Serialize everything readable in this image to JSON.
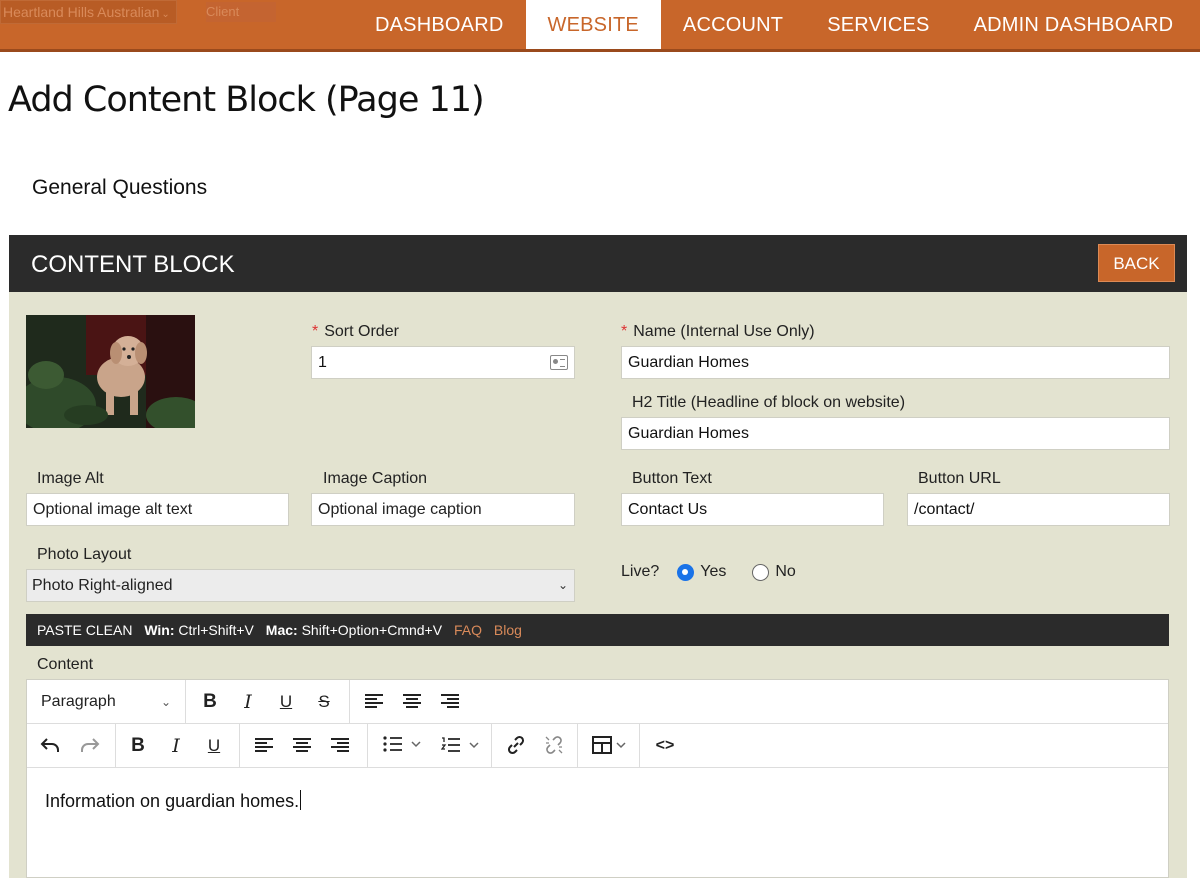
{
  "topnav": {
    "site_selector": "Heartland Hills Australian",
    "client_tag": "Client",
    "items": [
      {
        "label": "DASHBOARD"
      },
      {
        "label": "WEBSITE"
      },
      {
        "label": "ACCOUNT"
      },
      {
        "label": "SERVICES"
      },
      {
        "label": "ADMIN DASHBOARD"
      }
    ],
    "active": "WEBSITE"
  },
  "page": {
    "title": "Add Content Block (Page 11)",
    "group": "General Questions"
  },
  "panel": {
    "title": "CONTENT BLOCK",
    "back_label": "BACK"
  },
  "form": {
    "sort_order_label": "Sort Order",
    "sort_order_value": "1",
    "name_label": "Name (Internal Use Only)",
    "name_value": "Guardian Homes",
    "h2_label": "H2 Title (Headline of block on website)",
    "h2_value": "Guardian Homes",
    "image_alt_label": "Image Alt",
    "image_alt_value": "Optional image alt text",
    "image_caption_label": "Image Caption",
    "image_caption_value": "Optional image caption",
    "button_text_label": "Button Text",
    "button_text_value": "Contact Us",
    "button_url_label": "Button URL",
    "button_url_value": "/contact/",
    "photo_layout_label": "Photo Layout",
    "photo_layout_value": "Photo Right-aligned",
    "live_label": "Live?",
    "live_yes": "Yes",
    "live_no": "No",
    "live_selected": "Yes",
    "content_label": "Content",
    "required_mark": "*"
  },
  "paste_bar": {
    "title": "PASTE CLEAN",
    "win_label": "Win:",
    "win_keys": "Ctrl+Shift+V",
    "mac_label": "Mac:",
    "mac_keys": "Shift+Option+Cmnd+V",
    "faq_link": "FAQ",
    "blog_link": "Blog"
  },
  "editor": {
    "format_select": "Paragraph",
    "toolbar1": [
      "B",
      "I",
      "U",
      "S"
    ],
    "toolbar2": [
      "undo",
      "redo",
      "B",
      "I",
      "U"
    ],
    "code_label": "<>",
    "content": "Information on guardian homes."
  },
  "colors": {
    "brand_orange": "#c8662a",
    "dark_bar": "#2b2b2b",
    "panel_bg": "#e3e3d0",
    "radio_blue": "#1a73e8"
  }
}
